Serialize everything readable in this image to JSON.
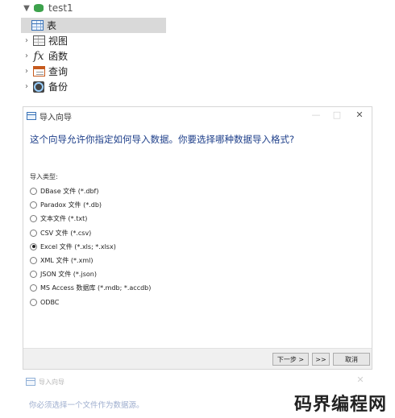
{
  "navigator": {
    "database": {
      "label": "test1"
    },
    "items": [
      {
        "label": "表",
        "icon": "table-icon"
      },
      {
        "label": "视图",
        "icon": "view-icon"
      },
      {
        "label": "函数",
        "icon": "function-icon"
      },
      {
        "label": "查询",
        "icon": "query-icon"
      },
      {
        "label": "备份",
        "icon": "backup-icon"
      }
    ]
  },
  "import_dialog": {
    "title": "导入向导",
    "window_controls": {
      "minimize": "—",
      "maximize": "□",
      "close": "✕"
    },
    "heading": "这个向导允许你指定如何导入数据。你要选择哪种数据导入格式?",
    "import_type_label": "导入类型:",
    "import_types": [
      {
        "label": "DBase 文件 (*.dbf)",
        "selected": false
      },
      {
        "label": "Paradox 文件 (*.db)",
        "selected": false
      },
      {
        "label": "文本文件 (*.txt)",
        "selected": false
      },
      {
        "label": "CSV 文件 (*.csv)",
        "selected": false
      },
      {
        "label": "Excel 文件 (*.xls; *.xlsx)",
        "selected": true
      },
      {
        "label": "XML 文件 (*.xml)",
        "selected": false
      },
      {
        "label": "JSON 文件 (*.json)",
        "selected": false
      },
      {
        "label": "MS Access 数据库 (*.mdb; *.accdb)",
        "selected": false
      },
      {
        "label": "ODBC",
        "selected": false
      }
    ],
    "buttons": {
      "next": "下一步 >",
      "last": ">>",
      "cancel": "取消"
    }
  },
  "second_dialog": {
    "title": "导入向导",
    "close": "✕",
    "heading": "你必须选择一个文件作为数据源。"
  },
  "watermark": "码界编程网"
}
